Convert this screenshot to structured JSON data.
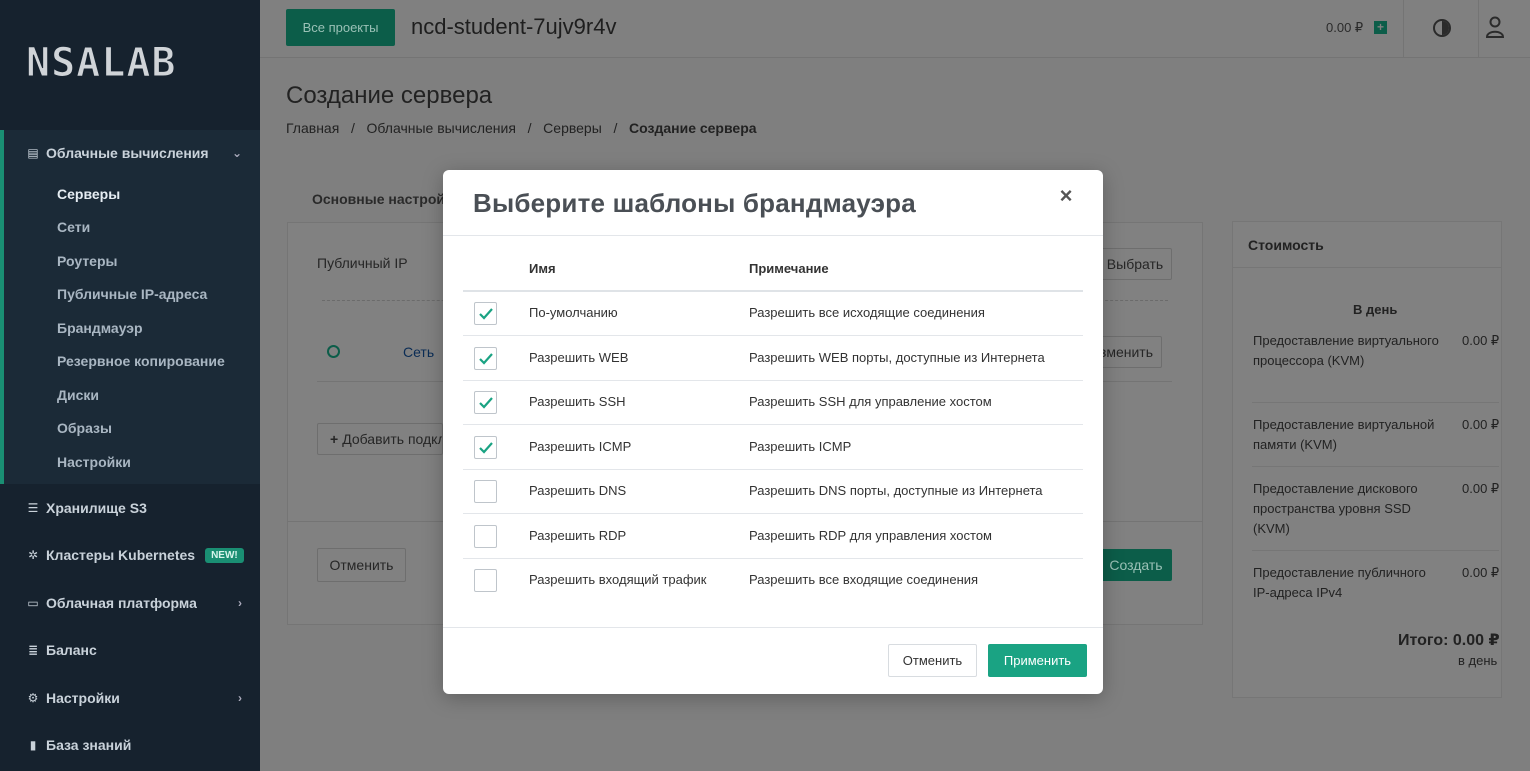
{
  "sidebar": {
    "logo_text": "NSALAB",
    "cloud_label": "Облачные вычисления",
    "sub_items": [
      "Серверы",
      "Сети",
      "Роутеры",
      "Публичные IP-адреса",
      "Брандмауэр",
      "Резервное копирование",
      "Диски",
      "Образы",
      "Настройки"
    ],
    "s3_label": "Хранилище S3",
    "k8s_label": "Кластеры Kubernetes",
    "k8s_badge": "NEW!",
    "platform_label": "Облачная платформа",
    "balance_label": "Баланс",
    "settings_label": "Настройки",
    "kb_label": "База знаний"
  },
  "topbar": {
    "projects_button": "Все проекты",
    "project_name": "ncd-student-7ujv9r4v",
    "balance": "0.00 ₽"
  },
  "page": {
    "title": "Создание сервера",
    "breadcrumb": [
      "Главная",
      "Облачные вычисления",
      "Серверы",
      "Создание сервера"
    ],
    "tab_main": "Основные настройки",
    "public_ip_label": "Публичный IP",
    "select_button": "Выбрать",
    "network_link": "Сеть",
    "change_button": "Изменить",
    "add_subnet_button": "Добавить подключение",
    "cancel_button": "Отменить",
    "create_button": "Создать"
  },
  "cost": {
    "title": "Стоимость",
    "per_day_header": "В день",
    "items": [
      {
        "name": "Предоставление виртуального процессора (KVM)",
        "value": "0.00 ₽"
      },
      {
        "name": "Предоставление виртуальной памяти (KVM)",
        "value": "0.00 ₽"
      },
      {
        "name": "Предоставление дискового пространства уровня SSD (KVM)",
        "value": "0.00 ₽"
      },
      {
        "name": "Предоставление публичного IP-адреса IPv4",
        "value": "0.00 ₽"
      }
    ],
    "total": "Итого: 0.00 ₽",
    "per_day": "в день"
  },
  "modal": {
    "title": "Выберите шаблоны брандмауэра",
    "close": "×",
    "col_name": "Имя",
    "col_note": "Примечание",
    "rows": [
      {
        "name": "По-умолчанию",
        "note": "Разрешить все исходящие соединения",
        "checked": true
      },
      {
        "name": "Разрешить WEB",
        "note": "Разрешить WEB порты, доступные из Интернета",
        "checked": true
      },
      {
        "name": "Разрешить SSH",
        "note": "Разрешить SSH для управление хостом",
        "checked": true
      },
      {
        "name": "Разрешить ICMP",
        "note": "Разрешить ICMP",
        "checked": true
      },
      {
        "name": "Разрешить DNS",
        "note": "Разрешить DNS порты, доступные из Интернета",
        "checked": false
      },
      {
        "name": "Разрешить RDP",
        "note": "Разрешить RDP для управления хостом",
        "checked": false
      },
      {
        "name": "Разрешить входящий трафик",
        "note": "Разрешить все входящие соединения",
        "checked": false
      }
    ],
    "cancel_button": "Отменить",
    "apply_button": "Применить",
    "accent_color": "#1aa383"
  }
}
